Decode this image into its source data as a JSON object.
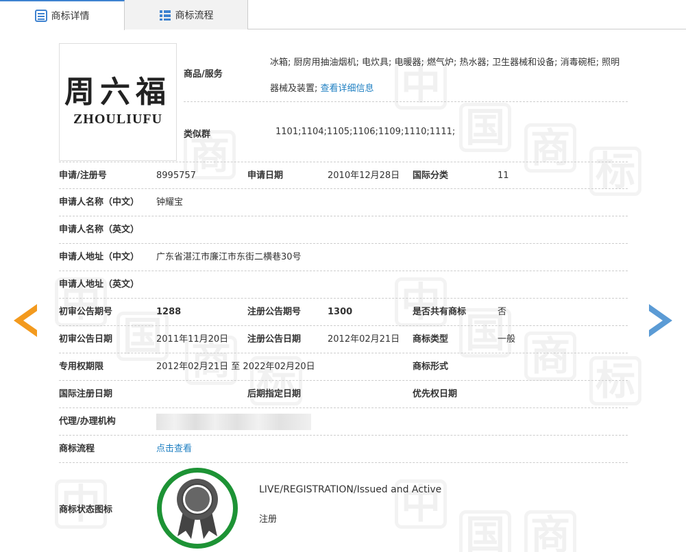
{
  "tabs": [
    {
      "label": "商标详情",
      "icon": "doc-list-icon"
    },
    {
      "label": "商标流程",
      "icon": "grid-list-icon"
    }
  ],
  "trademark": {
    "logo_cn": "周六福",
    "logo_en": "ZHOULIUFU",
    "goods_label": "商品/服务",
    "goods_text": "冰箱; 厨房用抽油烟机; 电炊具; 电暖器; 燃气炉; 热水器; 卫生器械和设备; 消毒碗柜; 照明器械及装置;",
    "goods_link": "查看详细信息",
    "group_label": "类似群",
    "group_text": "1101;1104;1105;1106;1109;1110;1111;"
  },
  "fields": {
    "reg_no_label": "申请/注册号",
    "reg_no": "8995757",
    "app_date_label": "申请日期",
    "app_date": "2010年12月28日",
    "intl_class_label": "国际分类",
    "intl_class": "11",
    "applicant_cn_label": "申请人名称（中文）",
    "applicant_cn": "钟耀宝",
    "applicant_en_label": "申请人名称（英文）",
    "address_cn_label": "申请人地址（中文）",
    "address_cn": "广东省湛江市廉江市东街二横巷30号",
    "address_en_label": "申请人地址（英文）",
    "prelim_no_label": "初审公告期号",
    "prelim_no": "1288",
    "reg_pub_no_label": "注册公告期号",
    "reg_pub_no": "1300",
    "shared_label": "是否共有商标",
    "shared": "否",
    "prelim_date_label": "初审公告日期",
    "prelim_date": "2011年11月20日",
    "reg_pub_date_label": "注册公告日期",
    "reg_pub_date": "2012年02月21日",
    "tm_type_label": "商标类型",
    "tm_type": "一般",
    "exclusive_label": "专用权期限",
    "exclusive": "2012年02月21日 至 2022年02月20日",
    "tm_form_label": "商标形式",
    "intl_reg_date_label": "国际注册日期",
    "later_date_label": "后期指定日期",
    "priority_date_label": "优先权日期",
    "agent_label": "代理/办理机构",
    "flow_label": "商标流程",
    "flow_link": "点击查看"
  },
  "status": {
    "label": "商标状态图标",
    "en": "LIVE/REGISTRATION/Issued and Active",
    "cn": "注册",
    "ring_color": "#1d9335"
  },
  "watermark_chars": [
    "中",
    "国",
    "商",
    "标"
  ]
}
